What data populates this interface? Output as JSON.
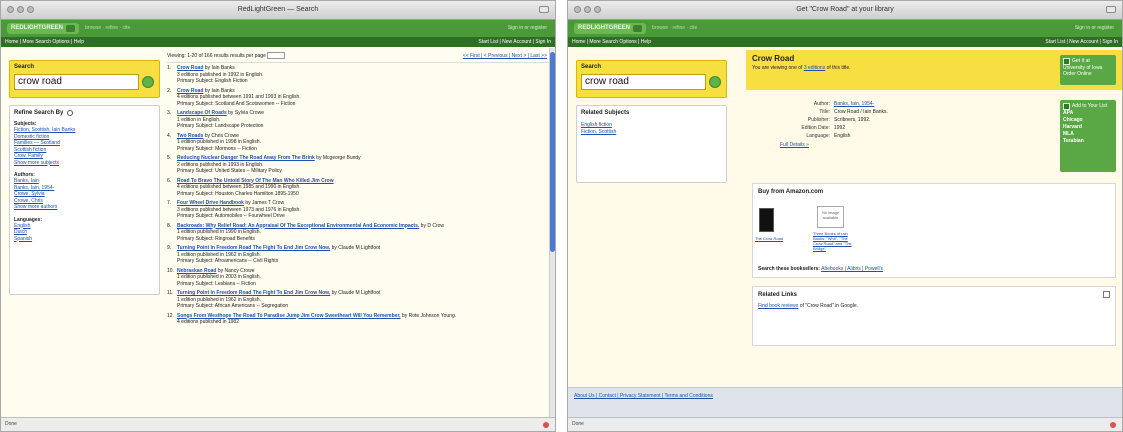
{
  "colors": {
    "brand_green": "#4a9a3a",
    "nav_green": "#2f6f24",
    "search_yellow": "#f7df42",
    "link_blue": "#1f4fb0",
    "page_bg": "#fffdf0"
  },
  "w1": {
    "title": "RedLightGreen — Search",
    "logo": "REDLIGHTGREEN",
    "tagline": "browse · refine · cite",
    "login": "Sign in or register",
    "nav_left": "Home | More Search Options | Help",
    "nav_right": "Start List | New Account | Sign In",
    "search_label": "Search",
    "search_value": "crow road",
    "refine_title": "Refine Search By",
    "subjects_h": "Subjects:",
    "subjects": [
      "Fiction, Scottish, Iain Banks",
      "Domestic fiction",
      "Families — Scotland",
      "Scottish fiction",
      "Crow, Family",
      "Show more subjects"
    ],
    "authors_h": "Authors:",
    "authors": [
      "Banks, Iain",
      "Banks, Iain, 1954-",
      "Crowe, Sylvia",
      "Crowe, Chris",
      "Show more authors"
    ],
    "lang_h": "Languages:",
    "langs": [
      "English",
      "Dutch",
      "Spanish"
    ],
    "viewbar": "Viewing: 1-20 of 166 results   results per page",
    "pager": "<< First | < Previous | Next > | Last >>",
    "results": [
      {
        "n": "1.",
        "t": "Crow Road",
        "d": "by Iain Banks",
        "a": "3 editions published in 1992 in English.",
        "b": "Primary Subject: English Fiction"
      },
      {
        "n": "2.",
        "t": "Crow Road",
        "d": "by Iain Banks",
        "a": "4 editions published between 1991 and 1993 in English.",
        "b": "Primary Subject: Scotland And Scotswomen -- Fiction"
      },
      {
        "n": "3.",
        "t": "Landscape Of Roads",
        "d": "by Sylvia Crowe",
        "a": "1 edition in English.",
        "b": "Primary Subject: Landscape Protection"
      },
      {
        "n": "4.",
        "t": "Two Roads",
        "d": "by Chris Crowe",
        "a": "1 edition published in 1998 in English.",
        "b": "Primary Subject: Mormons -- Fiction"
      },
      {
        "n": "5.",
        "t": "Reducing Nuclear Danger The Road Away From The Brink",
        "d": "by Mcgeorge Bundy",
        "a": "2 editions published in 1993 in English.",
        "b": "Primary Subject: United States -- Military Policy"
      },
      {
        "n": "6.",
        "t": "Road To Bravo The Untold Story Of The Man Who Killed Jim Crow",
        "d": "",
        "a": "4 editions published between 1985 and 1990 in English.",
        "b": "Primary Subject: Houston Charles Hamilton 1895-1950"
      },
      {
        "n": "7.",
        "t": "Four Wheel Drive Handbook",
        "d": "by James T Crow",
        "a": "3 editions published between 1973 and 1976 in English.",
        "b": "Primary Subject: Automobiles -- Fourwheel Drive"
      },
      {
        "n": "8.",
        "t": "Backroads: Why Relief Road: An Appraisal Of The Exceptional Environmental And Economic Impacts.",
        "d": "by D Crow",
        "a": "1 edition published in 1990 in English.",
        "b": "Primary Subject: Ringroad Benefits"
      },
      {
        "n": "9.",
        "t": "Turning Point In Freedom Road The Fight To End Jim Crow Now,",
        "d": "by Claude M Lightfoot",
        "a": "1 edition published in 1962 in English.",
        "b": "Primary Subject: Afroamericans -- Civil Rights"
      },
      {
        "n": "10.",
        "t": "Nebraskan Road",
        "d": "by Nancy Crowe",
        "a": "1 edition published in 2003 in English.",
        "b": "Primary Subject: Lesbians -- Fiction"
      },
      {
        "n": "11.",
        "t": "Turning Point In Freedom Road The Fight To End Jim Crow Now,",
        "d": "by Claude M Lightfoot",
        "a": "1 edition published in 1962 in English.",
        "b": "Primary Subject: African Americans -- Segregation"
      },
      {
        "n": "12.",
        "t": "Songs From Westhope The Road To Paradise Jump Jim Crow Sweetheart Will You Remember,",
        "d": "by Rote Johnson Young.",
        "a": "4 editions published in 1982",
        "b": ""
      }
    ],
    "status": "Done"
  },
  "w2": {
    "title": "Get \"Crow Road\" at your library",
    "logo": "REDLIGHTGREEN",
    "tagline": "browse · refine · cite",
    "login": "Sign in or register",
    "nav_left": "Home | More Search Options | Help",
    "nav_right": "Start List | New Account | Sign In",
    "search_label": "Search",
    "search_value": "crow road",
    "related_title": "Related Subjects",
    "related": [
      "English fiction",
      "Fiction, Scottish"
    ],
    "book_title": "Crow Road",
    "edition_pre": "You are viewing one of",
    "edition_link": "3 editions",
    "edition_post": "of this title.",
    "get_it": "Get It at University of Iowa",
    "get_sub": "Order Online",
    "meta": [
      {
        "k": "Author:",
        "v": "Banks, Iain, 1954-",
        "link": true
      },
      {
        "k": "Title:",
        "v": "Crow Road / Iain Banks.",
        "link": false
      },
      {
        "k": "Publisher:",
        "v": "Scribners, 1992.",
        "link": false
      },
      {
        "k": "Edition Date:",
        "v": "1992",
        "link": false
      },
      {
        "k": "Language:",
        "v": "English",
        "link": false
      }
    ],
    "full_details": "Full Details »",
    "add_list": "Add to Your List",
    "formats": [
      "APA",
      "Chicago",
      "Harvard",
      "MLA",
      "Turabian"
    ],
    "buy_title": "Buy from Amazon.com",
    "no_image": "No image available",
    "cover1_caption": "The Crow Road",
    "cover2_caption": "Three Books of Iain Banks: \"Whit\", \"The Crow Road\" and \"The Bridge\"",
    "stores_label": "Search these booksellers:",
    "stores": "Abebooks | Alibris | Powell's",
    "related_links": "Related Links",
    "google_link": "Find book reviews",
    "google_post": "of \"Crow Road\" in Google.",
    "footer": "About Us | Contact | Privacy Statement | Terms and Conditions",
    "status": "Done"
  }
}
